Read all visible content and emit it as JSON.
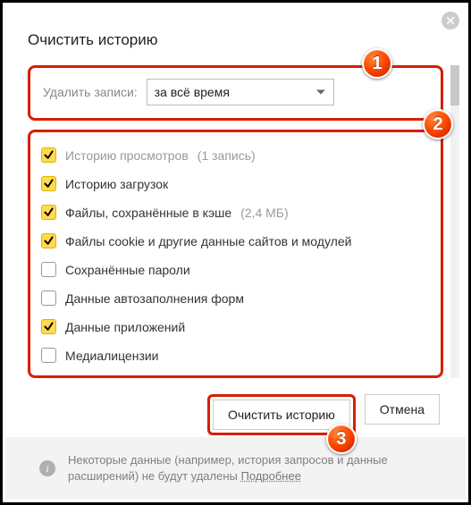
{
  "dialog": {
    "title": "Очистить историю",
    "delete_label": "Удалить записи:",
    "time_range_selected": "за всё время",
    "checkboxes": [
      {
        "label": "Историю просмотров",
        "suffix": "(1 запись)",
        "checked": true,
        "dim": true
      },
      {
        "label": "Историю загрузок",
        "checked": true
      },
      {
        "label": "Файлы, сохранённые в кэше",
        "suffix": "(2,4 МБ)",
        "checked": true
      },
      {
        "label": "Файлы cookie и другие данные сайтов и модулей",
        "checked": true
      },
      {
        "label": "Сохранённые пароли",
        "checked": false
      },
      {
        "label": "Данные автозаполнения форм",
        "checked": false
      },
      {
        "label": "Данные приложений",
        "checked": true
      },
      {
        "label": "Медиалицензии",
        "checked": false
      }
    ],
    "clear_button": "Очистить историю",
    "cancel_button": "Отмена"
  },
  "footer": {
    "text": "Некоторые данные (например, история запросов и данные расширений) не будут удалены ",
    "link": "Подробнее"
  },
  "badges": {
    "b1": "1",
    "b2": "2",
    "b3": "3"
  }
}
